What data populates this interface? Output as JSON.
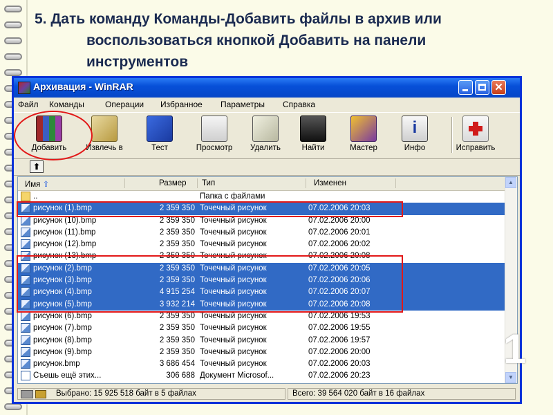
{
  "slide": {
    "title_line1": "5. Дать команду Команды-Добавить файлы в архив или",
    "title_line2": "воспользоваться кнопкой Добавить на панели",
    "title_line3": "инструментов",
    "number": "1"
  },
  "window": {
    "title": "Архивация - WinRAR",
    "close_glyph": "✕"
  },
  "menu": [
    "Файл",
    "Команды",
    "Операции",
    "Избранное",
    "Параметры",
    "Справка"
  ],
  "toolbar": [
    {
      "label": "Добавить",
      "icon": "add-archive-icon"
    },
    {
      "label": "Извлечь в",
      "icon": "extract-icon"
    },
    {
      "label": "Тест",
      "icon": "test-icon"
    },
    {
      "label": "Просмотр",
      "icon": "view-icon"
    },
    {
      "label": "Удалить",
      "icon": "delete-icon"
    },
    {
      "label": "Найти",
      "icon": "find-icon"
    },
    {
      "label": "Мастер",
      "icon": "wizard-icon"
    },
    {
      "label": "Инфо",
      "icon": "info-icon"
    },
    {
      "label": "Исправить",
      "icon": "repair-icon"
    }
  ],
  "info_glyph": "i",
  "up_glyph": "⬆",
  "columns": {
    "name": "Имя",
    "size": "Размер",
    "type": "Тип",
    "modified": "Изменен"
  },
  "rows": [
    {
      "name": "..",
      "size": "",
      "type": "Папка с файлами",
      "modified": "",
      "selected": false,
      "kind": "folder"
    },
    {
      "name": "рисунок (1).bmp",
      "size": "2 359 350",
      "type": "Точечный рисунок",
      "modified": "07.02.2006 20:03",
      "selected": true,
      "kind": "bmp"
    },
    {
      "name": "рисунок (10).bmp",
      "size": "2 359 350",
      "type": "Точечный рисунок",
      "modified": "07.02.2006 20:00",
      "selected": false,
      "kind": "bmp"
    },
    {
      "name": "рисунок (11).bmp",
      "size": "2 359 350",
      "type": "Точечный рисунок",
      "modified": "07.02.2006 20:01",
      "selected": false,
      "kind": "bmp"
    },
    {
      "name": "рисунок (12).bmp",
      "size": "2 359 350",
      "type": "Точечный рисунок",
      "modified": "07.02.2006 20:02",
      "selected": false,
      "kind": "bmp"
    },
    {
      "name": "рисунок (13).bmp",
      "size": "2 359 350",
      "type": "Точечный рисунок",
      "modified": "07.02.2006 20:08",
      "selected": false,
      "kind": "bmp"
    },
    {
      "name": "рисунок (2).bmp",
      "size": "2 359 350",
      "type": "Точечный рисунок",
      "modified": "07.02.2006 20:05",
      "selected": true,
      "kind": "bmp"
    },
    {
      "name": "рисунок (3).bmp",
      "size": "2 359 350",
      "type": "Точечный рисунок",
      "modified": "07.02.2006 20:06",
      "selected": true,
      "kind": "bmp"
    },
    {
      "name": "рисунок (4).bmp",
      "size": "4 915 254",
      "type": "Точечный рисунок",
      "modified": "07.02.2006 20:07",
      "selected": true,
      "kind": "bmp"
    },
    {
      "name": "рисунок (5).bmp",
      "size": "3 932 214",
      "type": "Точечный рисунок",
      "modified": "07.02.2006 20:08",
      "selected": true,
      "kind": "bmp"
    },
    {
      "name": "рисунок (6).bmp",
      "size": "2 359 350",
      "type": "Точечный рисунок",
      "modified": "07.02.2006 19:53",
      "selected": false,
      "kind": "bmp"
    },
    {
      "name": "рисунок (7).bmp",
      "size": "2 359 350",
      "type": "Точечный рисунок",
      "modified": "07.02.2006 19:55",
      "selected": false,
      "kind": "bmp"
    },
    {
      "name": "рисунок (8).bmp",
      "size": "2 359 350",
      "type": "Точечный рисунок",
      "modified": "07.02.2006 19:57",
      "selected": false,
      "kind": "bmp"
    },
    {
      "name": "рисунок (9).bmp",
      "size": "2 359 350",
      "type": "Точечный рисунок",
      "modified": "07.02.2006 20:00",
      "selected": false,
      "kind": "bmp"
    },
    {
      "name": "рисунок.bmp",
      "size": "3 686 454",
      "type": "Точечный рисунок",
      "modified": "07.02.2006 20:03",
      "selected": false,
      "kind": "bmp"
    },
    {
      "name": "Съешь ещё этих...",
      "size": "306 688",
      "type": "Документ Microsof...",
      "modified": "07.02.2006 20:23",
      "selected": false,
      "kind": "doc"
    }
  ],
  "status": {
    "left": "Выбрано: 15 925 518 байт в 5 файлах",
    "right": "Всего: 39 564 020 байт в 16 файлах"
  },
  "colors": {
    "selection": "#316ac5",
    "highlight": "#e21818",
    "titlebar": "#0750d8"
  }
}
